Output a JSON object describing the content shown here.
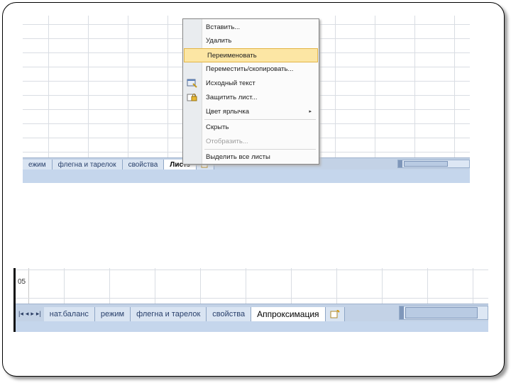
{
  "top_screenshot": {
    "tabs": [
      "ежим",
      "флегна и тарелок",
      "свойства",
      "Листз"
    ],
    "context_menu": {
      "items": [
        {
          "label": "Вставить..."
        },
        {
          "label": "Удалить"
        },
        {
          "label": "Переименовать",
          "highlighted": true
        },
        {
          "label": "Переместить/скопировать..."
        },
        {
          "label": "Исходный текст",
          "icon": "view-code-icon"
        },
        {
          "label": "Защитить лист...",
          "icon": "protect-sheet-icon"
        },
        {
          "label": "Цвет ярлычка",
          "submenu_arrow": "▸"
        },
        {
          "label": "Скрыть"
        },
        {
          "label": "Отобразить...",
          "disabled": true
        },
        {
          "label": "Выделить все листы"
        }
      ]
    }
  },
  "bottom_screenshot": {
    "row_label": "05",
    "nav_buttons": [
      "|◂",
      "◂",
      "▸",
      "▸|"
    ],
    "tabs": [
      "нат.баланс",
      "режим",
      "флегна и тарелок",
      "свойства",
      "Аппроксимация"
    ],
    "active_tab": "Аппроксимация"
  },
  "colors": {
    "tab_bar": "#c3d2e6",
    "menu_highlight": "#fce6a4",
    "status_bar": "#c5d6ec"
  }
}
